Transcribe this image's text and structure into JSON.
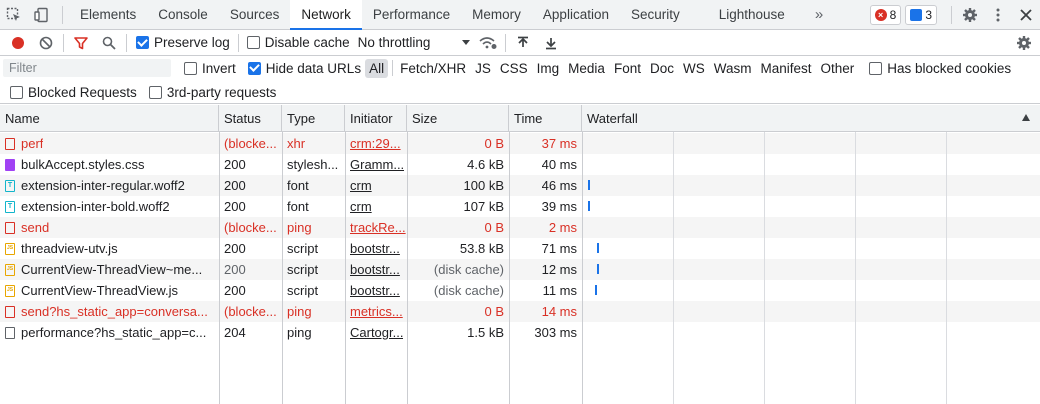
{
  "tabs": [
    {
      "label": "Elements"
    },
    {
      "label": "Console"
    },
    {
      "label": "Sources"
    },
    {
      "label": "Network",
      "active": true
    },
    {
      "label": "Performance"
    },
    {
      "label": "Memory"
    },
    {
      "label": "Application"
    },
    {
      "label": "Security"
    },
    {
      "label": "Lighthouse"
    }
  ],
  "more_tabs": "»",
  "badges": {
    "errors": "8",
    "messages": "3"
  },
  "toolbar": {
    "preserve_log": {
      "label": "Preserve log",
      "checked": true
    },
    "disable_cache": {
      "label": "Disable cache",
      "checked": false
    },
    "throttling": "No throttling"
  },
  "filter": {
    "placeholder": "Filter",
    "value": "",
    "invert": {
      "label": "Invert",
      "checked": false
    },
    "hide_data_urls": {
      "label": "Hide data URLs",
      "checked": true
    },
    "types": [
      "All",
      "Fetch/XHR",
      "JS",
      "CSS",
      "Img",
      "Media",
      "Font",
      "Doc",
      "WS",
      "Wasm",
      "Manifest",
      "Other"
    ],
    "active_type": "All",
    "has_blocked_cookies": {
      "label": "Has blocked cookies",
      "checked": false
    },
    "blocked_requests": {
      "label": "Blocked Requests",
      "checked": false
    },
    "third_party": {
      "label": "3rd-party requests",
      "checked": false
    }
  },
  "columns": {
    "name": "Name",
    "status": "Status",
    "type": "Type",
    "initiator": "Initiator",
    "size": "Size",
    "time": "Time",
    "waterfall": "Waterfall"
  },
  "requests": [
    {
      "name": "perf",
      "status": "(blocke...",
      "type": "xhr",
      "initiator": "crm:29...",
      "size": "0 B",
      "time": "37 ms",
      "kind": "err",
      "blocked": true,
      "waterfall": null
    },
    {
      "name": "bulkAccept.styles.css",
      "status": "200",
      "type": "stylesh...",
      "initiator": "Gramm...",
      "size": "4.6 kB",
      "time": "40 ms",
      "kind": "css",
      "blocked": false,
      "waterfall": null
    },
    {
      "name": "extension-inter-regular.woff2",
      "status": "200",
      "type": "font",
      "initiator": "crm",
      "size": "100 kB",
      "time": "46 ms",
      "kind": "font",
      "blocked": false,
      "waterfall": 0.0
    },
    {
      "name": "extension-inter-bold.woff2",
      "status": "200",
      "type": "font",
      "initiator": "crm",
      "size": "107 kB",
      "time": "39 ms",
      "kind": "font",
      "blocked": false,
      "waterfall": 0.0
    },
    {
      "name": "send",
      "status": "(blocke...",
      "type": "ping",
      "initiator": "trackRe...",
      "size": "0 B",
      "time": "2 ms",
      "kind": "err",
      "blocked": true,
      "waterfall": null
    },
    {
      "name": "threadview-utv.js",
      "status": "200",
      "type": "script",
      "initiator": "bootstr...",
      "size": "53.8 kB",
      "time": "71 ms",
      "kind": "script",
      "blocked": false,
      "waterfall": 0.02
    },
    {
      "name": "CurrentView-ThreadView~me...",
      "status": "200",
      "type": "script",
      "initiator": "bootstr...",
      "size": "(disk cache)",
      "time": "12 ms",
      "kind": "script",
      "blocked": false,
      "waterfall": 0.02,
      "status_muted": true
    },
    {
      "name": "CurrentView-ThreadView.js",
      "status": "200",
      "type": "script",
      "initiator": "bootstr...",
      "size": "(disk cache)",
      "time": "11 ms",
      "kind": "script",
      "blocked": false,
      "waterfall": 0.015
    },
    {
      "name": "send?hs_static_app=conversa...",
      "status": "(blocke...",
      "type": "ping",
      "initiator": "metrics...",
      "size": "0 B",
      "time": "14 ms",
      "kind": "err",
      "blocked": true,
      "waterfall": null
    },
    {
      "name": "performance?hs_static_app=c...",
      "status": "204",
      "type": "ping",
      "initiator": "Cartogr...",
      "size": "1.5 kB",
      "time": "303 ms",
      "kind": "doc",
      "blocked": false,
      "waterfall": null
    }
  ]
}
